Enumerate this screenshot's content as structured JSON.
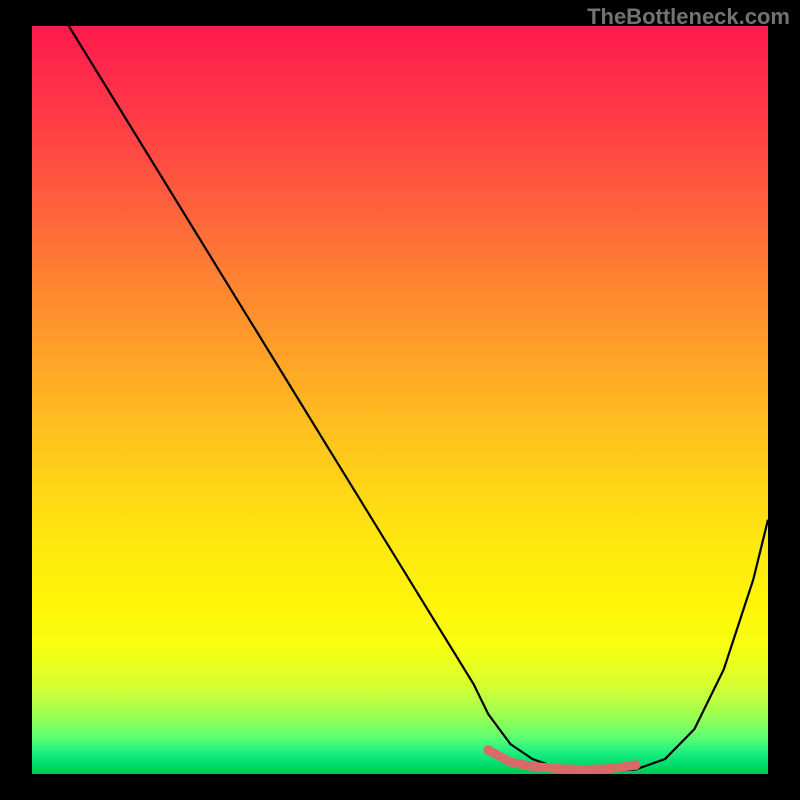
{
  "watermark": "TheBottleneck.com",
  "chart_data": {
    "type": "line",
    "title": "",
    "x_range": [
      0,
      100
    ],
    "y_range": [
      0,
      100
    ],
    "curve": {
      "x": [
        5,
        10,
        15,
        20,
        25,
        30,
        35,
        40,
        45,
        50,
        55,
        60,
        62,
        65,
        68,
        72,
        75,
        78,
        82,
        86,
        90,
        94,
        98,
        100
      ],
      "y": [
        100,
        92,
        84,
        76,
        68,
        60,
        52,
        44,
        36,
        28,
        20,
        12,
        8,
        4,
        2,
        0.6,
        0.4,
        0.4,
        0.6,
        2,
        6,
        14,
        26,
        34
      ]
    },
    "highlight_segment": {
      "x": [
        62,
        65,
        68,
        72,
        75,
        78,
        80,
        82
      ],
      "y": [
        3.2,
        1.6,
        1.0,
        0.7,
        0.6,
        0.7,
        0.9,
        1.2
      ]
    },
    "gradient_stops": [
      {
        "pos": 0,
        "color": "#ff1a4d"
      },
      {
        "pos": 50,
        "color": "#ffc01e"
      },
      {
        "pos": 80,
        "color": "#fff608"
      },
      {
        "pos": 100,
        "color": "#00c850"
      }
    ],
    "xlabel": "",
    "ylabel": "",
    "legend": []
  }
}
